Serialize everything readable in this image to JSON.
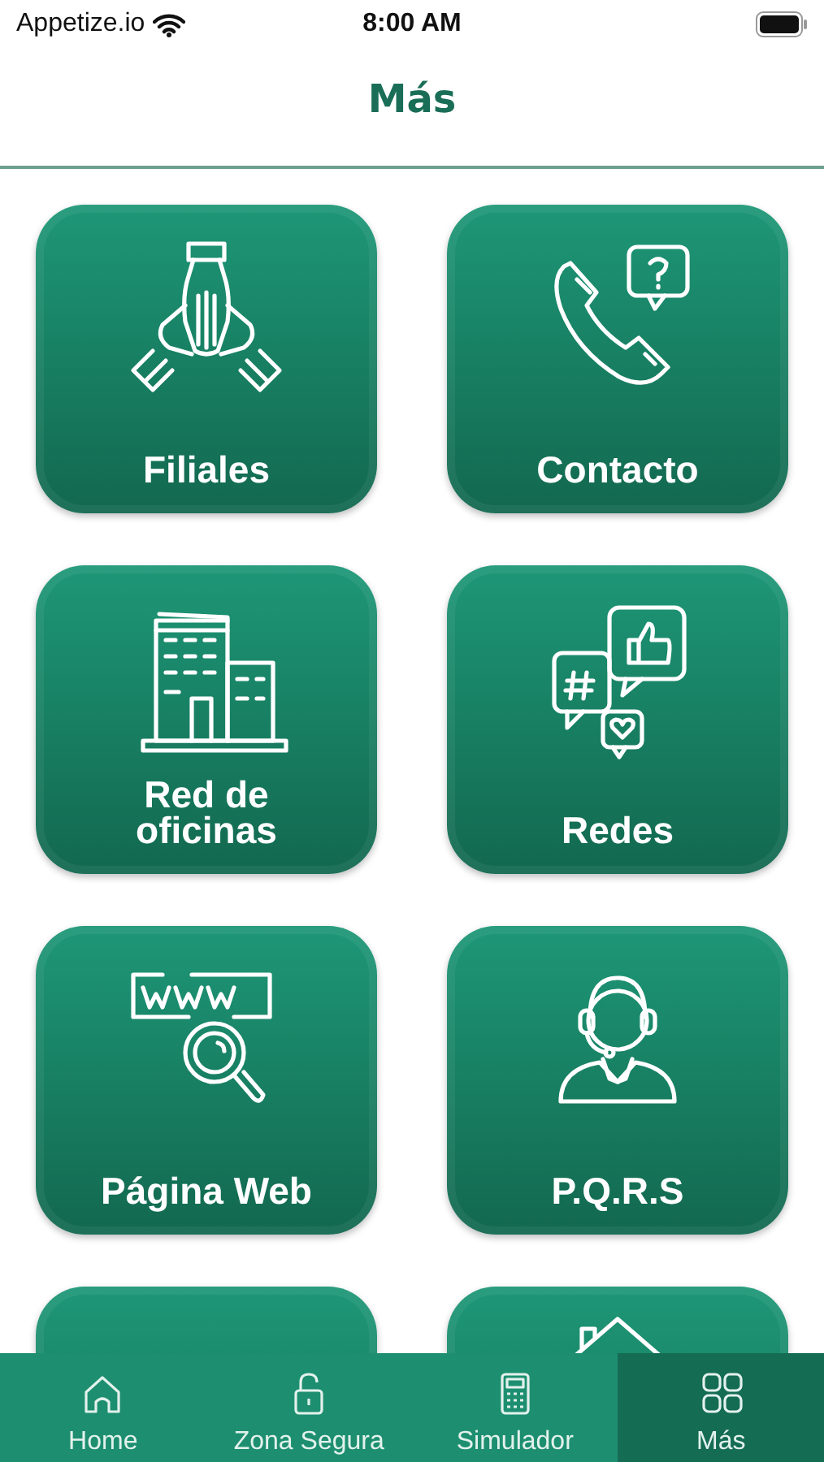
{
  "status_bar": {
    "carrier": "Appetize.io",
    "time": "8:00 AM"
  },
  "header": {
    "title": "Más"
  },
  "tiles": [
    {
      "kind": "full",
      "label": "Filiales"
    },
    {
      "kind": "full",
      "label": "Contacto"
    },
    {
      "kind": "full",
      "label": "Red de oficinas"
    },
    {
      "kind": "full",
      "label": "Redes"
    },
    {
      "kind": "full",
      "label": "Página Web"
    },
    {
      "kind": "full",
      "label": "P.Q.R.S"
    },
    {
      "kind": "cut"
    },
    {
      "kind": "cut"
    }
  ],
  "tab_bar": [
    {
      "label": "Home",
      "selected": false
    },
    {
      "label": "Zona Segura",
      "selected": false
    },
    {
      "label": "Simulador",
      "selected": false
    },
    {
      "label": "Más",
      "selected": true
    }
  ]
}
